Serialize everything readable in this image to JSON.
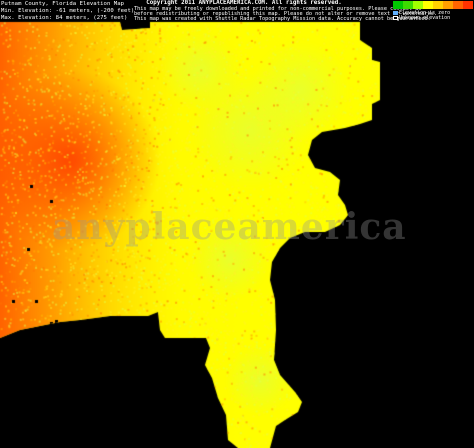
{
  "header": {
    "title": "Putnam County, Florida Elevation Map",
    "min_elevation": "Min. Elevation: -61 meters, (-200 feet)",
    "max_elevation": "Max. Elevation: 84 meters, (275 feet)"
  },
  "notice": {
    "copyright": "Copyright 2011 ANYPLACEAMERICA.COM.  All rights reserved.",
    "line2": "This map may be freely downloaded and printed for non-commercial purposes. Please contact us",
    "line3": "before redistributing or republishing this map.  Please do not alter or remove text or watermarks.",
    "line4": "This map was created with Shuttle Radar Topography Mission data.  Accuracy cannot be guaranteed."
  },
  "legend": {
    "scale_colors": [
      "#00c800",
      "#3cdc00",
      "#a0ff00",
      "#ffff00",
      "#ffd200",
      "#ffa000",
      "#ff6400",
      "#ff3200"
    ],
    "elevation_zero_label": "Elevation is zero",
    "elevation_unknown_label": "Unknown elevation",
    "zero_color": "#60b0ff",
    "unknown_color": "#000000"
  },
  "watermark": "anyplaceamerica",
  "colors": {
    "background": "#000000",
    "low": "#ffff00",
    "mid": "#ffb400",
    "high": "#ff5000"
  }
}
